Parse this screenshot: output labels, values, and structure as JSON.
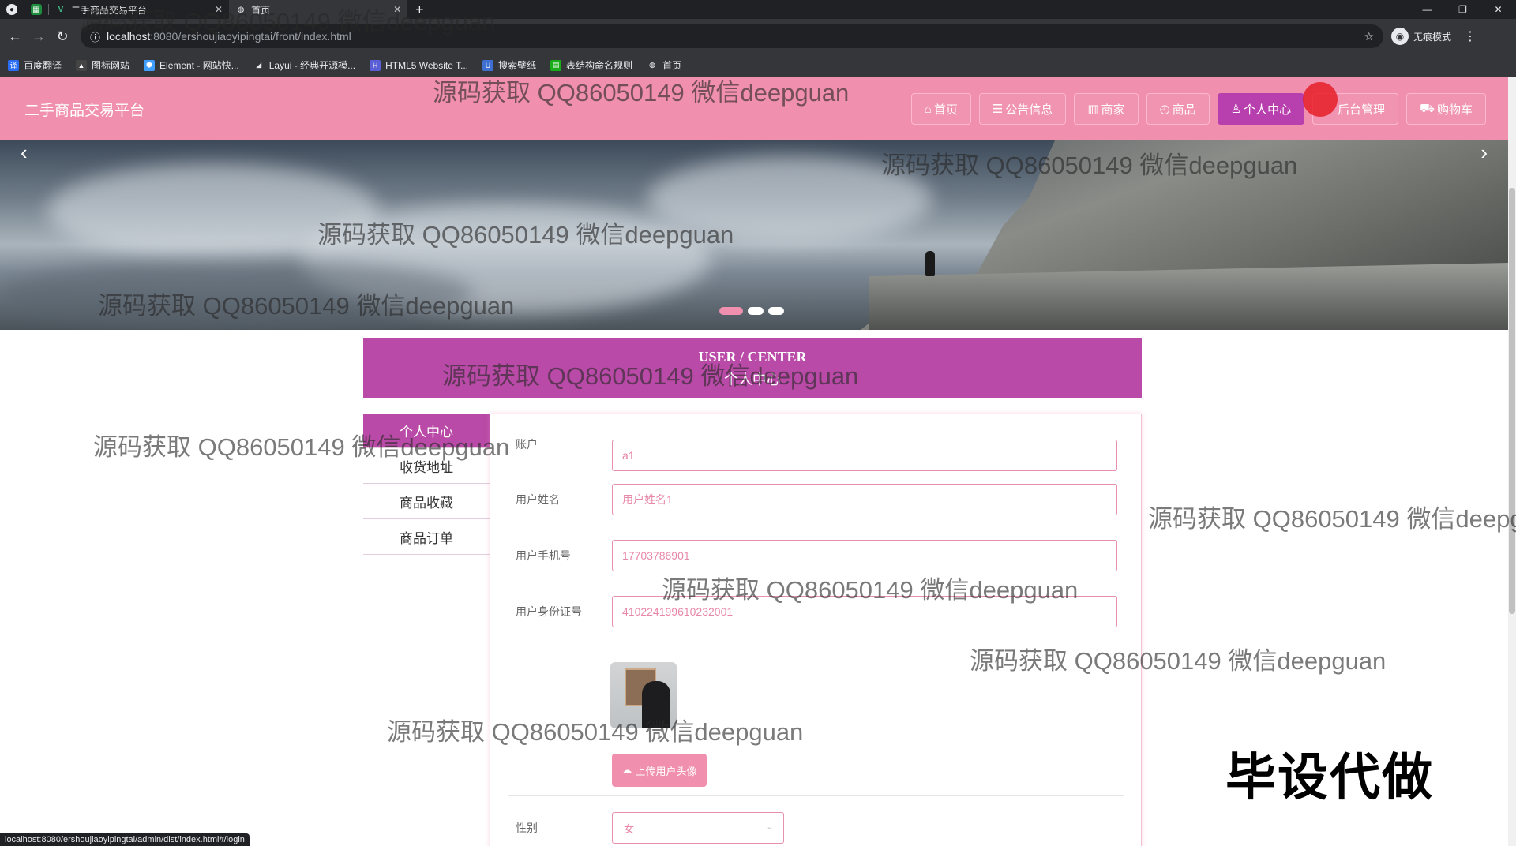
{
  "browser": {
    "tabs": [
      {
        "label": "",
        "icon": "chrome-icon"
      },
      {
        "label": "",
        "icon": "sheet-icon"
      },
      {
        "label": "二手商品交易平台",
        "icon": "vue-icon"
      },
      {
        "label": "首页",
        "icon": "globe-icon"
      }
    ],
    "url_host": "localhost",
    "url_path": ":8080/ershoujiaoyipingtai/front/index.html",
    "profile_label": "无痕模式",
    "bookmarks": [
      {
        "label": "百度翻译",
        "color": "#2a6df4"
      },
      {
        "label": "图标网站",
        "color": "#444444"
      },
      {
        "label": "Element - 网站快...",
        "color": "#409eff"
      },
      {
        "label": "Layui - 经典开源模...",
        "color": "#009688"
      },
      {
        "label": "HTML5 Website T...",
        "color": "#5a5fd6"
      },
      {
        "label": "搜索壁纸",
        "color": "#3f6fd1"
      },
      {
        "label": "表结构命名规则",
        "color": "#1aad19"
      },
      {
        "label": "首页",
        "color": "#777777"
      }
    ],
    "status_url": "localhost:8080/ershoujiaoyipingtai/admin/dist/index.html#/login"
  },
  "header": {
    "title": "二手商品交易平台",
    "nav": [
      {
        "label": "首页",
        "icon": "home-icon",
        "glyph": "⌂"
      },
      {
        "label": "公告信息",
        "icon": "news-icon",
        "glyph": "☰"
      },
      {
        "label": "商家",
        "icon": "shop-icon",
        "glyph": "▥"
      },
      {
        "label": "商品",
        "icon": "goods-icon",
        "glyph": "◴"
      },
      {
        "label": "个人中心",
        "icon": "user-icon",
        "glyph": "♙"
      },
      {
        "label": "后台管理",
        "icon": "admin-icon",
        "glyph": ""
      },
      {
        "label": "购物车",
        "icon": "cart-icon",
        "glyph": "⛟"
      }
    ],
    "active_nav": "个人中心",
    "colors": {
      "header_bg": "#f08fae",
      "accent": "#b94aa7"
    }
  },
  "banner": {
    "slides": 3,
    "active_slide": 1
  },
  "user_center": {
    "title_en": "USER / CENTER",
    "title_cn": "个人中心"
  },
  "side_menu": [
    {
      "label": "个人中心",
      "active": true
    },
    {
      "label": "收货地址",
      "active": false
    },
    {
      "label": "商品收藏",
      "active": false
    },
    {
      "label": "商品订单",
      "active": false
    }
  ],
  "form": {
    "account": {
      "label": "账户",
      "value": "a1"
    },
    "name": {
      "label": "用户姓名",
      "value": "用户姓名1"
    },
    "phone": {
      "label": "用户手机号",
      "value": "17703786901"
    },
    "id_card": {
      "label": "用户身份证号",
      "value": "410224199610232001"
    },
    "upload_label": "上传用户头像",
    "gender": {
      "label": "性别",
      "value": "女"
    }
  },
  "watermark": "源码获取 QQ86050149 微信deepguan",
  "stamp_text": "毕设代做"
}
